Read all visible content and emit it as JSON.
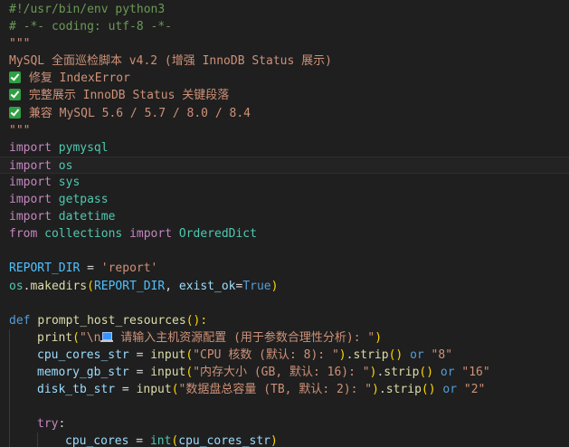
{
  "colors": {
    "comment": "#6a9955",
    "keyword": "#c586c0",
    "storage": "#569cd6",
    "constant": "#4fc1ff",
    "variable": "#9cdcfe",
    "function": "#dcdcaa",
    "class": "#4ec9b0",
    "string": "#ce9178",
    "number": "#b5cea8",
    "text": "#d4d4d4",
    "bracket1": "#ffd700",
    "bracket2": "#da70d6",
    "bracket3": "#179fff",
    "docstring": "#ce9178",
    "param": "#9cdcfe"
  },
  "editor": {
    "current_line": 9,
    "lines": [
      {
        "indent": 0,
        "tokens": [
          {
            "t": "#!/usr/bin/env python3",
            "c": "comment"
          }
        ]
      },
      {
        "indent": 0,
        "tokens": [
          {
            "t": "# -*- coding: utf-8 -*-",
            "c": "comment"
          }
        ]
      },
      {
        "indent": 0,
        "tokens": [
          {
            "t": "\"\"\"",
            "c": "docstring"
          }
        ]
      },
      {
        "indent": 0,
        "tokens": [
          {
            "t": "MySQL 全面巡检脚本 v4.2 (增强 InnoDB Status 展示)",
            "c": "docstring"
          }
        ]
      },
      {
        "indent": 0,
        "tokens": [
          {
            "icon": "check-mark-icon"
          },
          {
            "t": " 修复 IndexError",
            "c": "docstring"
          }
        ]
      },
      {
        "indent": 0,
        "tokens": [
          {
            "icon": "check-mark-icon"
          },
          {
            "t": " 完整展示 InnoDB Status 关键段落",
            "c": "docstring"
          }
        ]
      },
      {
        "indent": 0,
        "tokens": [
          {
            "icon": "check-mark-icon"
          },
          {
            "t": " 兼容 MySQL 5.6 / 5.7 / 8.0 / 8.4",
            "c": "docstring"
          }
        ]
      },
      {
        "indent": 0,
        "tokens": [
          {
            "t": "\"\"\"",
            "c": "docstring"
          }
        ]
      },
      {
        "indent": 0,
        "tokens": [
          {
            "t": "import",
            "c": "keyword"
          },
          {
            "t": " ",
            "c": "text"
          },
          {
            "t": "pymysql",
            "c": "class"
          }
        ]
      },
      {
        "indent": 0,
        "tokens": [
          {
            "t": "import",
            "c": "keyword"
          },
          {
            "t": " ",
            "c": "text"
          },
          {
            "t": "os",
            "c": "class"
          }
        ]
      },
      {
        "indent": 0,
        "tokens": [
          {
            "t": "import",
            "c": "keyword"
          },
          {
            "t": " ",
            "c": "text"
          },
          {
            "t": "sys",
            "c": "class"
          }
        ]
      },
      {
        "indent": 0,
        "tokens": [
          {
            "t": "import",
            "c": "keyword"
          },
          {
            "t": " ",
            "c": "text"
          },
          {
            "t": "getpass",
            "c": "class"
          }
        ]
      },
      {
        "indent": 0,
        "tokens": [
          {
            "t": "import",
            "c": "keyword"
          },
          {
            "t": " ",
            "c": "text"
          },
          {
            "t": "datetime",
            "c": "class"
          }
        ]
      },
      {
        "indent": 0,
        "tokens": [
          {
            "t": "from",
            "c": "keyword"
          },
          {
            "t": " ",
            "c": "text"
          },
          {
            "t": "collections",
            "c": "class"
          },
          {
            "t": " ",
            "c": "text"
          },
          {
            "t": "import",
            "c": "keyword"
          },
          {
            "t": " ",
            "c": "text"
          },
          {
            "t": "OrderedDict",
            "c": "class"
          }
        ]
      },
      {
        "indent": 0,
        "tokens": []
      },
      {
        "indent": 0,
        "tokens": [
          {
            "t": "REPORT_DIR",
            "c": "constant"
          },
          {
            "t": " = ",
            "c": "text"
          },
          {
            "t": "'report'",
            "c": "string"
          }
        ]
      },
      {
        "indent": 0,
        "tokens": [
          {
            "t": "os",
            "c": "class"
          },
          {
            "t": ".",
            "c": "text"
          },
          {
            "t": "makedirs",
            "c": "function"
          },
          {
            "t": "(",
            "c": "bracket1"
          },
          {
            "t": "REPORT_DIR",
            "c": "constant"
          },
          {
            "t": ", ",
            "c": "text"
          },
          {
            "t": "exist_ok",
            "c": "param"
          },
          {
            "t": "=",
            "c": "text"
          },
          {
            "t": "True",
            "c": "storage"
          },
          {
            "t": ")",
            "c": "bracket1"
          }
        ]
      },
      {
        "indent": 0,
        "tokens": []
      },
      {
        "indent": 0,
        "tokens": [
          {
            "t": "def",
            "c": "storage"
          },
          {
            "t": " ",
            "c": "text"
          },
          {
            "t": "prompt_host_resources",
            "c": "function"
          },
          {
            "t": "():",
            "c": "bracket1"
          }
        ]
      },
      {
        "indent": 1,
        "tokens": [
          {
            "t": "print",
            "c": "function"
          },
          {
            "t": "(",
            "c": "bracket1"
          },
          {
            "t": "\"\\n",
            "c": "string"
          },
          {
            "icon": "laptop-icon"
          },
          {
            "t": " 请输入主机资源配置 (用于参数合理性分析): \"",
            "c": "string"
          },
          {
            "t": ")",
            "c": "bracket1"
          }
        ]
      },
      {
        "indent": 1,
        "tokens": [
          {
            "t": "cpu_cores_str",
            "c": "variable"
          },
          {
            "t": " = ",
            "c": "text"
          },
          {
            "t": "input",
            "c": "function"
          },
          {
            "t": "(",
            "c": "bracket1"
          },
          {
            "t": "\"CPU 核数 (默认: 8): \"",
            "c": "string"
          },
          {
            "t": ")",
            "c": "bracket1"
          },
          {
            "t": ".",
            "c": "text"
          },
          {
            "t": "strip",
            "c": "function"
          },
          {
            "t": "()",
            "c": "bracket1"
          },
          {
            "t": " ",
            "c": "text"
          },
          {
            "t": "or",
            "c": "storage"
          },
          {
            "t": " ",
            "c": "text"
          },
          {
            "t": "\"8\"",
            "c": "string"
          }
        ]
      },
      {
        "indent": 1,
        "tokens": [
          {
            "t": "memory_gb_str",
            "c": "variable"
          },
          {
            "t": " = ",
            "c": "text"
          },
          {
            "t": "input",
            "c": "function"
          },
          {
            "t": "(",
            "c": "bracket1"
          },
          {
            "t": "\"内存大小 (GB, 默认: 16): \"",
            "c": "string"
          },
          {
            "t": ")",
            "c": "bracket1"
          },
          {
            "t": ".",
            "c": "text"
          },
          {
            "t": "strip",
            "c": "function"
          },
          {
            "t": "()",
            "c": "bracket1"
          },
          {
            "t": " ",
            "c": "text"
          },
          {
            "t": "or",
            "c": "storage"
          },
          {
            "t": " ",
            "c": "text"
          },
          {
            "t": "\"16\"",
            "c": "string"
          }
        ]
      },
      {
        "indent": 1,
        "tokens": [
          {
            "t": "disk_tb_str",
            "c": "variable"
          },
          {
            "t": " = ",
            "c": "text"
          },
          {
            "t": "input",
            "c": "function"
          },
          {
            "t": "(",
            "c": "bracket1"
          },
          {
            "t": "\"数据盘总容量 (TB, 默认: 2): \"",
            "c": "string"
          },
          {
            "t": ")",
            "c": "bracket1"
          },
          {
            "t": ".",
            "c": "text"
          },
          {
            "t": "strip",
            "c": "function"
          },
          {
            "t": "()",
            "c": "bracket1"
          },
          {
            "t": " ",
            "c": "text"
          },
          {
            "t": "or",
            "c": "storage"
          },
          {
            "t": " ",
            "c": "text"
          },
          {
            "t": "\"2\"",
            "c": "string"
          }
        ]
      },
      {
        "indent": 1,
        "tokens": []
      },
      {
        "indent": 1,
        "tokens": [
          {
            "t": "try",
            "c": "keyword"
          },
          {
            "t": ":",
            "c": "text"
          }
        ]
      },
      {
        "indent": 2,
        "tokens": [
          {
            "t": "cpu_cores",
            "c": "variable"
          },
          {
            "t": " = ",
            "c": "text"
          },
          {
            "t": "int",
            "c": "class"
          },
          {
            "t": "(",
            "c": "bracket1"
          },
          {
            "t": "cpu_cores_str",
            "c": "variable"
          },
          {
            "t": ")",
            "c": "bracket1"
          }
        ]
      }
    ]
  }
}
